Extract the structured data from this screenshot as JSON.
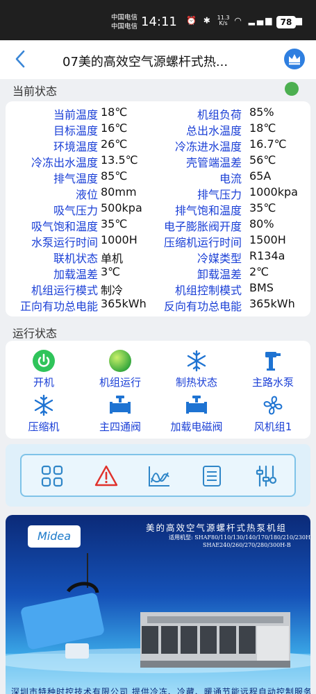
{
  "status_bar": {
    "carrier_1": "中国电信",
    "carrier_2": "中国电信",
    "time": "14:11",
    "net_speed_value": "11.3",
    "net_speed_unit": "K/s",
    "battery": "78"
  },
  "header": {
    "title": "07美的高效空气源螺杆式热..."
  },
  "current_status": {
    "section_title": "当前状态",
    "online_color": "#4caf50",
    "rows": [
      {
        "l_label": "当前温度",
        "l_value": "18℃",
        "r_label": "机组负荷",
        "r_value": "85%"
      },
      {
        "l_label": "目标温度",
        "l_value": "16℃",
        "r_label": "总出水温度",
        "r_value": "18℃"
      },
      {
        "l_label": "环境温度",
        "l_value": "26℃",
        "r_label": "冷冻进水温度",
        "r_value": "16.7℃"
      },
      {
        "l_label": "冷冻出水温度",
        "l_value": "13.5℃",
        "r_label": "壳管端温差",
        "r_value": "56℃"
      },
      {
        "l_label": "排气温度",
        "l_value": "85℃",
        "r_label": "电流",
        "r_value": "65A"
      },
      {
        "l_label": "液位",
        "l_value": "80mm",
        "r_label": "排气压力",
        "r_value": "1000kpa"
      },
      {
        "l_label": "吸气压力",
        "l_value": "500kpa",
        "r_label": "排气饱和温度",
        "r_value": "35℃"
      },
      {
        "l_label": "吸气饱和温度",
        "l_value": "35℃",
        "r_label": "电子膨胀阀开度",
        "r_value": "80%"
      },
      {
        "l_label": "水泵运行时间",
        "l_value": "1000H",
        "r_label": "压缩机运行时间",
        "r_value": "1500H"
      },
      {
        "l_label": "联机状态",
        "l_value": "单机",
        "r_label": "冷媒类型",
        "r_value": "R134a"
      },
      {
        "l_label": "加载温差",
        "l_value": "3℃",
        "r_label": "卸载温差",
        "r_value": "2℃"
      },
      {
        "l_label": "机组运行模式",
        "l_value": "制冷",
        "r_label": "机组控制模式",
        "r_value": "BMS"
      },
      {
        "l_label": "正向有功总电能",
        "l_value": "365kWh",
        "r_label": "反向有功总电能",
        "r_value": "365kWh"
      }
    ]
  },
  "run_status": {
    "section_title": "运行状态",
    "items": [
      {
        "label": "开机",
        "icon": "power-on-icon"
      },
      {
        "label": "机组运行",
        "icon": "running-indicator-icon"
      },
      {
        "label": "制热状态",
        "icon": "snowflake-icon"
      },
      {
        "label": "主路水泵",
        "icon": "water-pump-icon"
      },
      {
        "label": "压缩机",
        "icon": "snowflake-icon"
      },
      {
        "label": "主四通阀",
        "icon": "valve-icon"
      },
      {
        "label": "加载电磁阀",
        "icon": "valve-icon"
      },
      {
        "label": "风机组1",
        "icon": "fan-icon"
      }
    ]
  },
  "toolbar": {
    "tools": [
      "grid-menu-icon",
      "alarm-warning-icon",
      "trend-chart-icon",
      "list-document-icon",
      "settings-sliders-icon"
    ]
  },
  "banner": {
    "brand": "Midea",
    "title": "美的高效空气源螺杆式热泵机组",
    "models_line1": "适用机型: SHAF80/110/130/140/170/180/210/230H",
    "models_line2": "SHAE240/260/270/280/300H-B",
    "footer": "深圳市特种时控技术有限公司    提供冷冻、冷藏、暖通节能远程自动控制服务"
  },
  "colors": {
    "accent": "#3a86d6",
    "label_blue": "#1a3fd6",
    "status_green": "#4caf50"
  }
}
